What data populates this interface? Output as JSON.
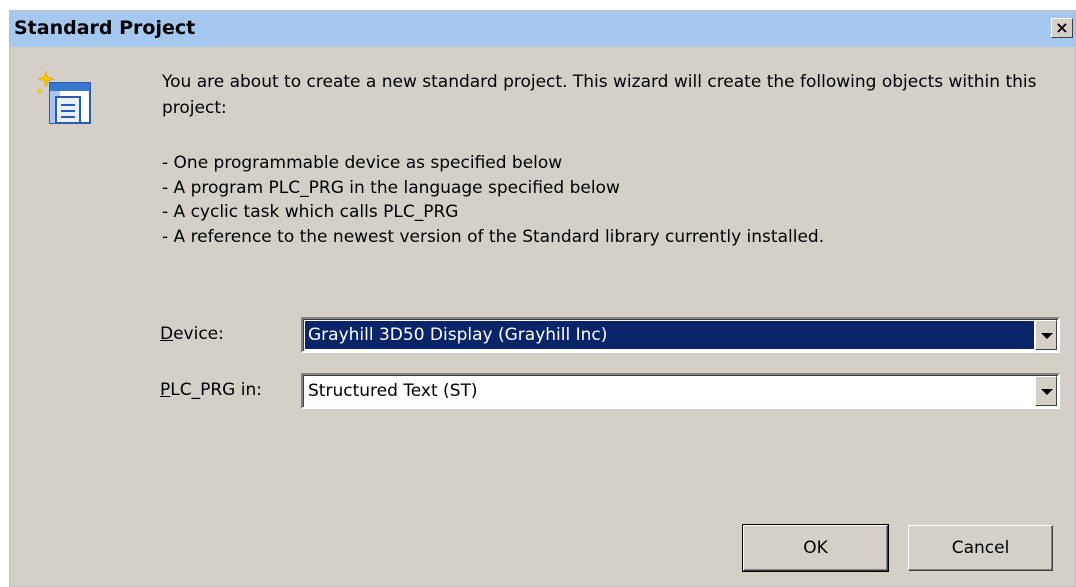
{
  "window": {
    "title": "Standard Project",
    "close_glyph": "×"
  },
  "icons": {
    "wizard": "new-project-wizard-icon",
    "close": "close-icon",
    "dropdown": "chevron-down-icon"
  },
  "intro": {
    "text": "You are about to create a new standard project. This wizard will create the following objects within this project:"
  },
  "bullets": [
    "- One programmable device as specified below",
    "- A program PLC_PRG in the language specified below",
    "- A cyclic task which calls PLC_PRG",
    "- A reference to the newest version of the Standard library currently installed."
  ],
  "fields": {
    "device": {
      "label_accel": "D",
      "label_rest": "evice:",
      "value": "Grayhill 3D50 Display (Grayhill Inc)"
    },
    "plc_prg": {
      "label_accel": "P",
      "label_rest": "LC_PRG in:",
      "value": "Structured Text (ST)"
    }
  },
  "buttons": {
    "ok": "OK",
    "cancel": "Cancel"
  },
  "colors": {
    "titlebar": "#a6c8ee",
    "dialog_bg": "#d4d0c8",
    "selection": "#0a246a"
  }
}
